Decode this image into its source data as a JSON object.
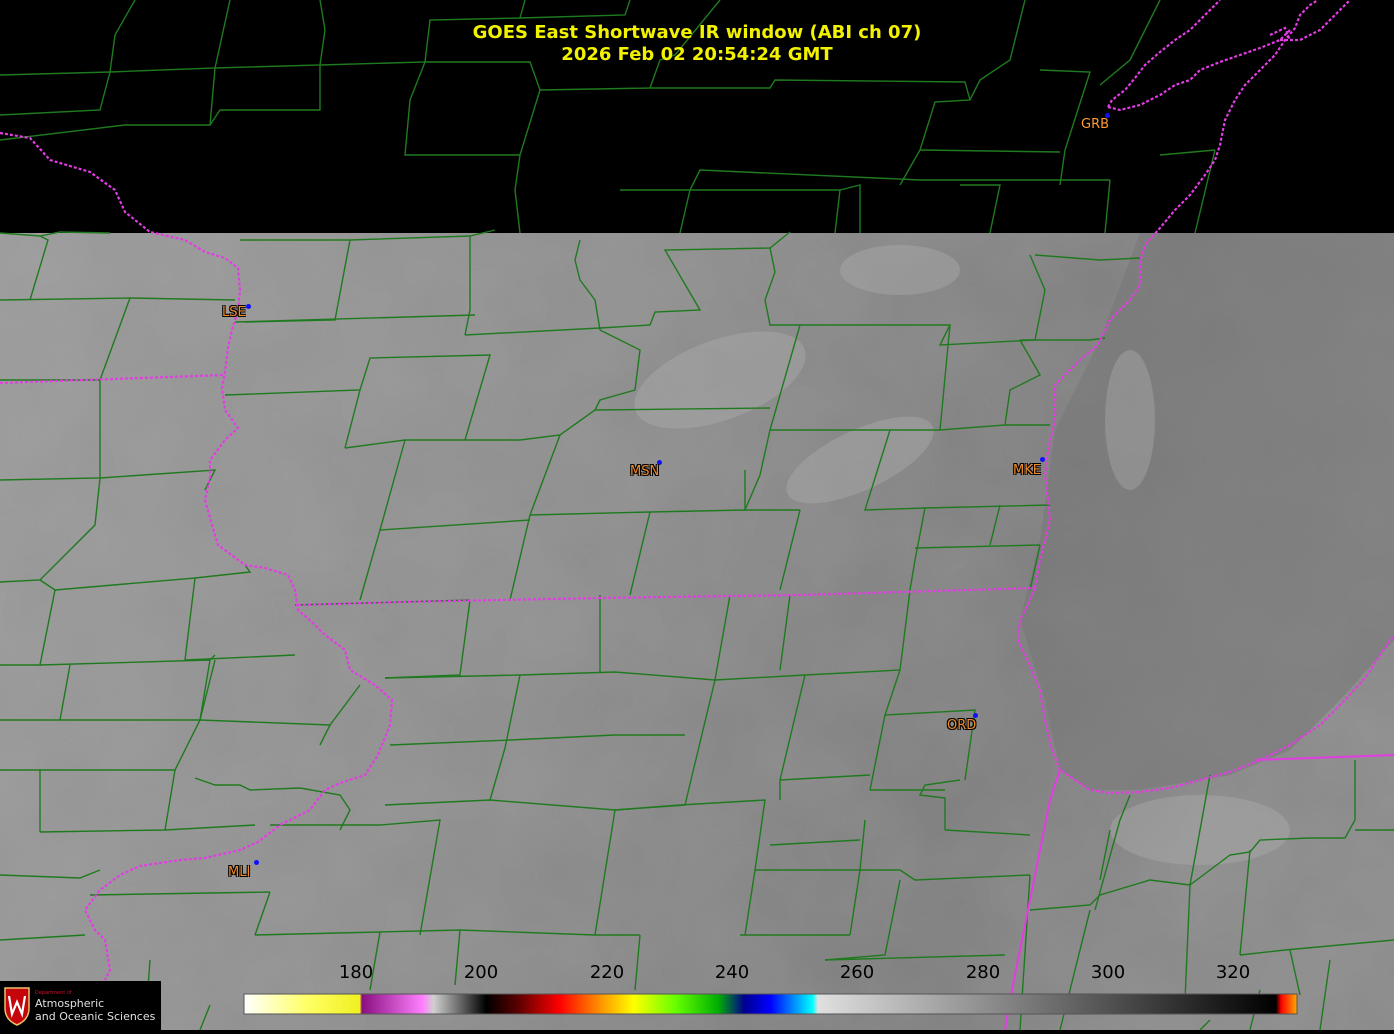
{
  "title": {
    "line1": "GOES East Shortwave IR window (ABI ch 07)",
    "line2": "2026 Feb 02  20:54:24 GMT"
  },
  "stations": [
    {
      "id": "GRB",
      "style": "plain"
    },
    {
      "id": "LSE",
      "style": "outlined"
    },
    {
      "id": "MSN",
      "style": "outlined"
    },
    {
      "id": "MKE",
      "style": "outlined"
    },
    {
      "id": "ORD",
      "style": "outlined"
    },
    {
      "id": "MLI",
      "style": "outlined"
    }
  ],
  "colorbar": {
    "ticks": [
      "180",
      "200",
      "220",
      "240",
      "260",
      "280",
      "300",
      "320"
    ],
    "range": [
      162,
      330
    ],
    "unit_hint": "brightness temperature (K)"
  },
  "logo": {
    "department": "Department of",
    "line1": "Atmospheric",
    "line2": "and Oceanic Sciences"
  },
  "colors": {
    "title": "#f2f200",
    "county_lines": "#1f7a1f",
    "state_lines": "#e43ce4",
    "station_label": "#f08a2a",
    "station_dot": "#1010ff",
    "background": "#000000"
  }
}
